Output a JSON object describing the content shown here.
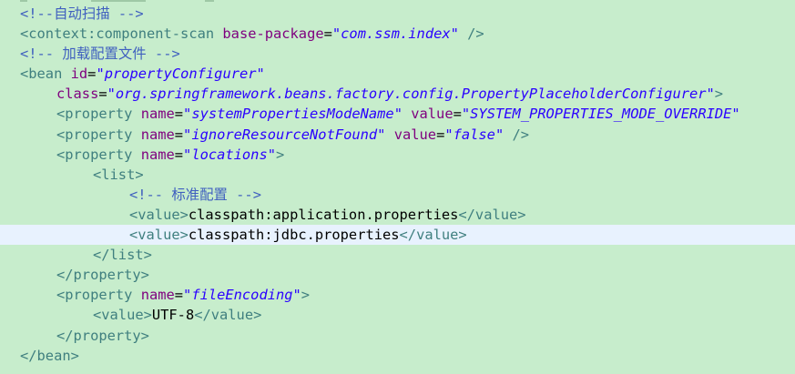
{
  "code": {
    "comment_autoscan": "<!--自动扫描 -->",
    "context_open": "<context:component-scan",
    "context_attr": "base-package",
    "context_value": "\"com.ssm.index\"",
    "context_close": " />",
    "comment_load": "<!-- 加载配置文件 -->",
    "bean_open": "<bean",
    "bean_id_attr": "id",
    "bean_id_value": "\"propertyConfigurer\"",
    "class_attr": "class",
    "class_value": "\"org.springframework.beans.factory.config.PropertyPlaceholderConfigurer\"",
    "class_close": ">",
    "prop1_open": "<property",
    "prop1_name_attr": "name",
    "prop1_name_value": "\"systemPropertiesModeName\"",
    "prop1_value_attr": "value",
    "prop1_value_value": "\"SYSTEM_PROPERTIES_MODE_OVERRIDE\"",
    "prop2_open": "<property",
    "prop2_name_attr": "name",
    "prop2_name_value": "\"ignoreResourceNotFound\"",
    "prop2_value_attr": "value",
    "prop2_value_value": "\"false\"",
    "prop2_close": " />",
    "prop3_open": "<property",
    "prop3_name_attr": "name",
    "prop3_name_value": "\"locations\"",
    "prop3_close": ">",
    "list_open": "<list>",
    "comment_standard": "<!-- 标准配置 -->",
    "value_open": "<value>",
    "value_close": "</value>",
    "value1_text": "classpath:application.properties",
    "value2_text": "classpath:jdbc.properties",
    "list_close": "</list>",
    "property_close": "</property>",
    "prop4_open": "<property",
    "prop4_name_attr": "name",
    "prop4_name_value": "\"fileEncoding\"",
    "prop4_close": ">",
    "value3_text": "UTF-8",
    "bean_close": "</bean>",
    "eq": "="
  }
}
